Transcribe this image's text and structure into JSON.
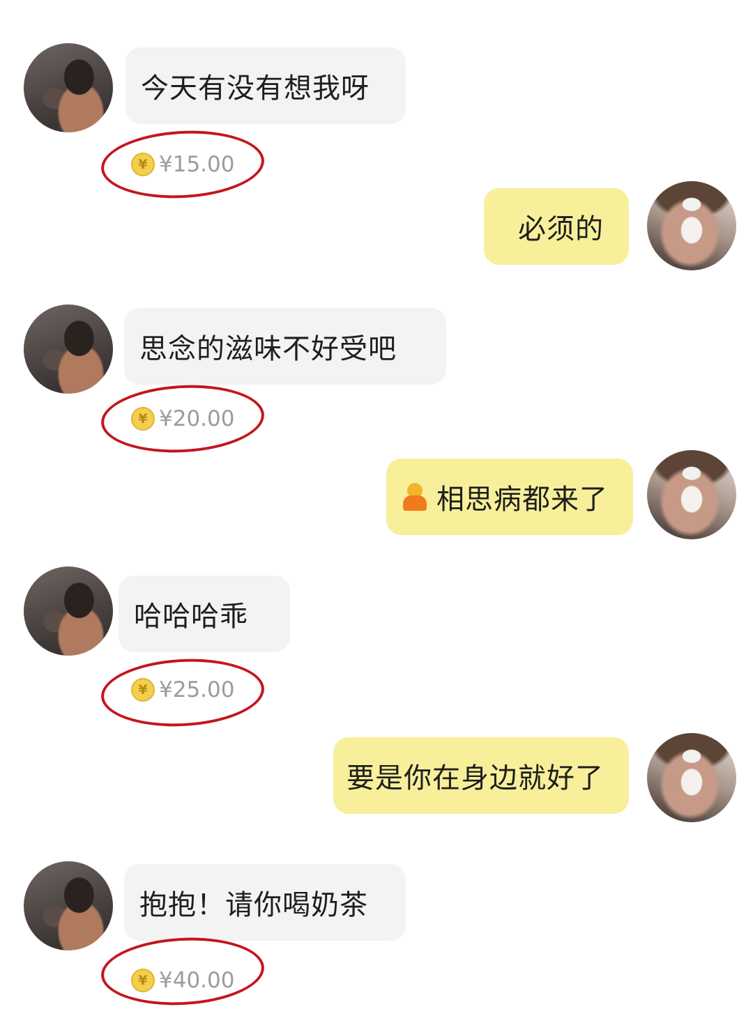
{
  "messages": [
    {
      "side": "left",
      "text": "今天有没有想我呀",
      "amount": "¥15.00"
    },
    {
      "side": "right",
      "text": "必须的"
    },
    {
      "side": "left",
      "text": "思念的滋味不好受吧",
      "amount": "¥20.00"
    },
    {
      "side": "right",
      "text": "相思病都来了",
      "emoji": "person-emoji-icon"
    },
    {
      "side": "left",
      "text": "哈哈哈乖",
      "amount": "¥25.00"
    },
    {
      "side": "right",
      "text": "要是你在身边就好了"
    },
    {
      "side": "left",
      "text": "抱抱！请你喝奶茶",
      "amount": "¥40.00"
    }
  ],
  "coin_symbol": "¥",
  "colors": {
    "incoming_bubble": "#f3f3f4",
    "outgoing_bubble": "#f8ef9b",
    "highlight_ring": "#c4161c",
    "coin": "#f3cf4f"
  }
}
